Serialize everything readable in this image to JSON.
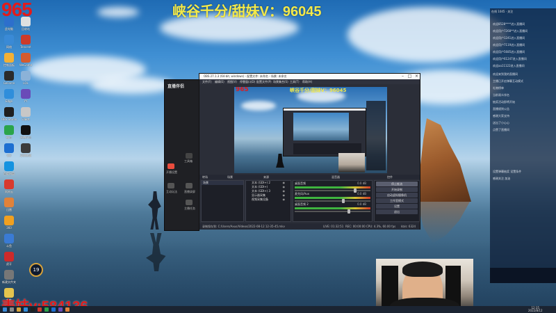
{
  "overlays": {
    "top_left": "965",
    "top_center": "峡谷千分/甜妹V：96045",
    "bottom_left": "表妹v:584136"
  },
  "obs": {
    "title": "OBS 27.1.3 (64-bit, windows) - 配置文件: 未命名 - 场景: 未命名",
    "menus": [
      "文件(F)",
      "编辑(E)",
      "视图(V)",
      "停靠窗口(D)",
      "配置文件(P)",
      "场景集合(S)",
      "工具(T)",
      "帮助(H)"
    ],
    "docks": {
      "scenes": "场景",
      "sources": "来源",
      "mixer": "混音器",
      "transitions": "转场",
      "controls": "控件"
    },
    "scenes": [
      "场景"
    ],
    "sources": [
      "文本 (GDI+) 2",
      "文本 (GDI+)",
      "文本 (GDI+) 3",
      "显示器采集",
      "视频采集设备"
    ],
    "mixer": [
      {
        "name": "桌面音频",
        "db": "0.0 dB",
        "level": 0.78
      },
      {
        "name": "麦克风/Aux",
        "db": "0.0 dB",
        "level": 0.62
      },
      {
        "name": "桌面音频 2",
        "db": "0.0 dB",
        "level": 0.7
      }
    ],
    "controls": [
      "停止推流",
      "开始录制",
      "启动虚拟摄像机",
      "工作室模式",
      "设置",
      "退出"
    ],
    "controls_active": "停止推流",
    "status": {
      "recording_path": "录制保存到: C:/Users/Axus/Videos/2022-08-12 12-35-45.mkv",
      "dropped": "00:00:00",
      "live": "LIVE: 01:32:51",
      "rec": "REC: 00:00:00",
      "cpu": "CPU: 4.3%, 60.00 fps",
      "kbps": "kb/s: 6324"
    }
  },
  "app": {
    "logo": "直播伴侣",
    "labels": [
      "开播设置",
      "互动玩法",
      "工具箱",
      "直播录屏",
      "主播任务"
    ]
  },
  "chat": {
    "header": "在线 1045  ·  关注",
    "lines": [
      "欢迎8528****进入直播间",
      "欢迎用户7268**进入直播间",
      "欢迎用户1241进入直播间",
      "欢迎用户7119进入直播间",
      "欢迎用户5685进入直播间",
      "欢迎用户61247进入直播间",
      "欢迎aa11122进入直播间",
      "欢迎来到我的直播间",
      "主播已开启弹幕互动模式",
      "礼物榜单",
      "当前观众排名",
      "抽奖活动即将开始",
      "直播规则公告",
      "感谢大家支持",
      "送出了小心心",
      "点赞了直播间"
    ],
    "bottom_lines": [
      "设置弹幕抽奖 设置条件",
      "感谢关注 加油"
    ],
    "count": "19"
  },
  "taskbar": {
    "time": "12:35",
    "date": "2022/8/12"
  },
  "colors": {
    "overlay_red": "#e21b1b",
    "overlay_yellow": "#f3e94a",
    "obs_bg": "#2b2e38"
  }
}
